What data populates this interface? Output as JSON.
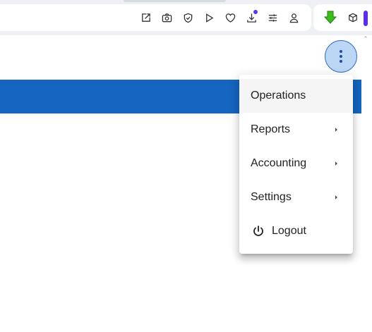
{
  "browser": {
    "toolbar_icons": [
      "edit-icon",
      "camera-icon",
      "shield-icon",
      "play-icon",
      "heart-icon",
      "download-icon",
      "sliders-icon",
      "profile-icon"
    ],
    "extensions": [
      "green-download-arrow-icon",
      "cube-icon",
      "purple-bar"
    ]
  },
  "page": {
    "more_menu_icon": "more-vert-icon",
    "header_color": "#1565c0"
  },
  "menu": {
    "items": [
      {
        "label": "Operations",
        "has_submenu": false
      },
      {
        "label": "Reports",
        "has_submenu": true
      },
      {
        "label": "Accounting",
        "has_submenu": true
      },
      {
        "label": "Settings",
        "has_submenu": true
      },
      {
        "label": "Logout",
        "icon": "power-icon"
      }
    ]
  }
}
